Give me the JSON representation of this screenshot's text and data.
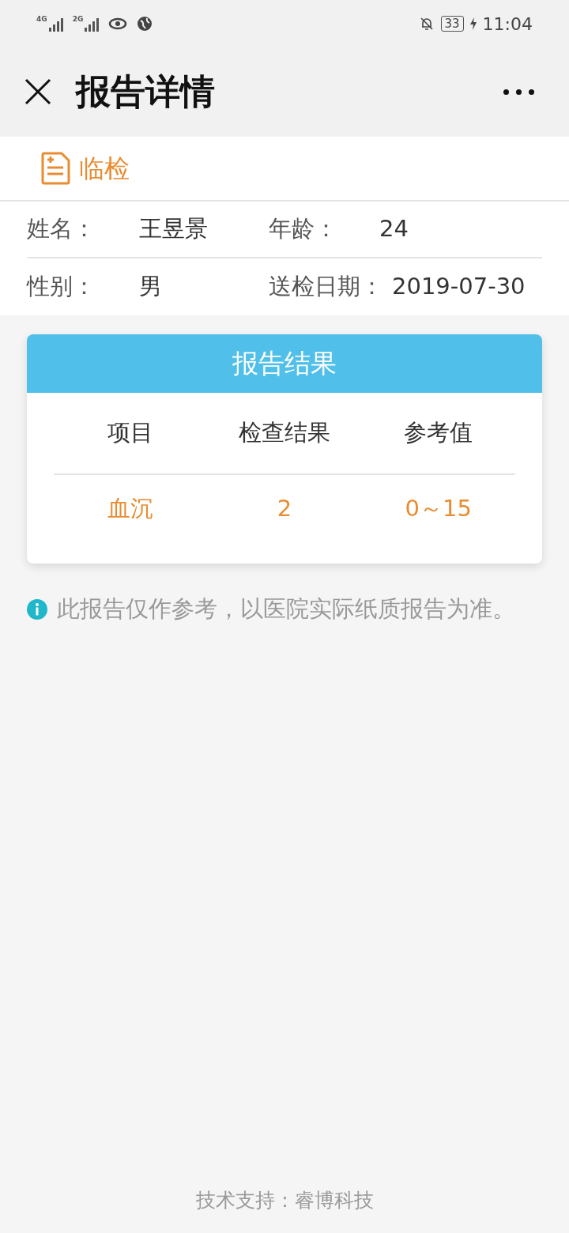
{
  "status_bar": {
    "signals": [
      "4G",
      "2G"
    ],
    "battery": "33",
    "time": "11:04"
  },
  "header": {
    "title": "报告详情"
  },
  "category": {
    "label": "临检"
  },
  "patient": [
    {
      "label": "姓名：",
      "value": "王昱景"
    },
    {
      "label": "年龄：",
      "value": "24"
    },
    {
      "label": "性别：",
      "value": "男"
    },
    {
      "label": "送检日期：",
      "value": "2019-07-30"
    }
  ],
  "report": {
    "title": "报告结果",
    "columns": [
      "项目",
      "检查结果",
      "参考值"
    ],
    "rows": [
      [
        "血沉",
        "2",
        "0～15"
      ]
    ]
  },
  "notice": "此报告仅作参考，以医院实际纸质报告为准。",
  "footer": "技术支持：睿博科技"
}
